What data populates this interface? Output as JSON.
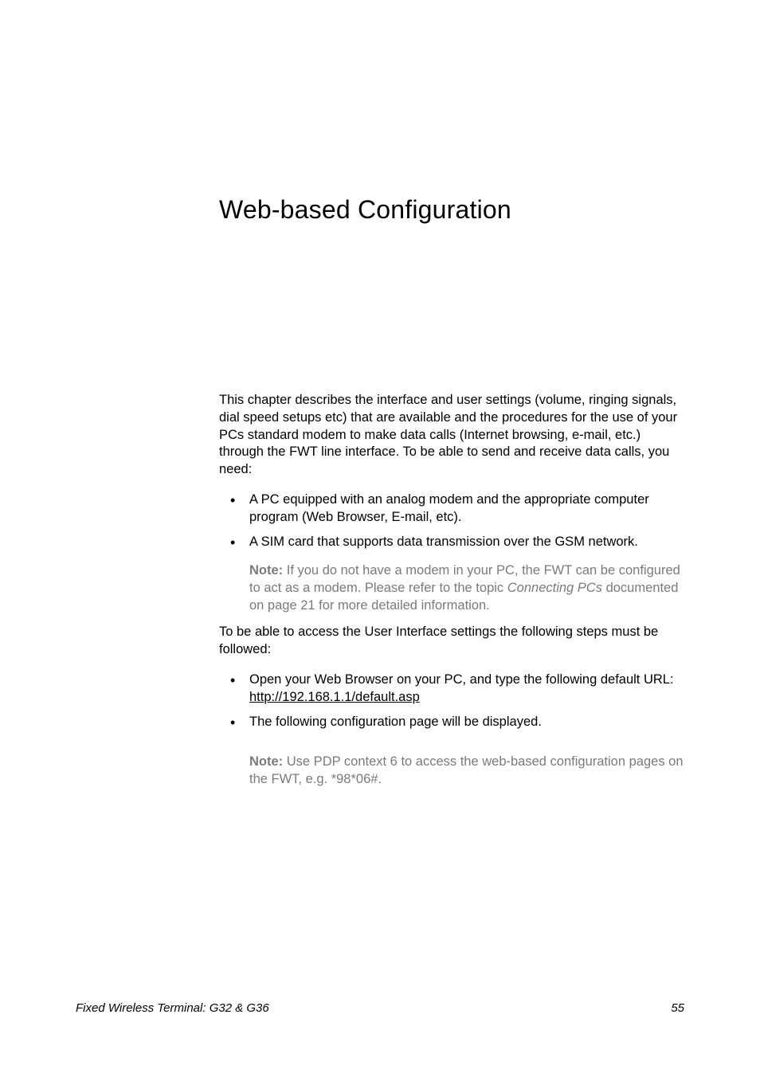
{
  "page": {
    "chapterTitle": "Web-based Configuration",
    "introParagraph": "This chapter describes the interface and user settings (volume, ringing signals, dial speed setups etc) that are available and the procedures for the use of your PCs standard modem to make data calls (Internet browsing, e-mail, etc.) through the FWT line interface. To be able to send and receive data calls, you need:",
    "requirements": [
      "A PC equipped with an analog modem and the appropriate computer program (Web Browser, E-mail, etc).",
      "A SIM card that supports data transmission over the GSM network."
    ],
    "note1": {
      "label": "Note:",
      "text_before": " If you do not have a modem in your PC, the FWT can be configured to act as a modem. Please refer to the topic ",
      "italic": "Connecting PCs",
      "text_after": " documented on page 21 for more detailed information."
    },
    "accessParagraph": "To be able to access the User Interface settings the following steps must be followed:",
    "steps": [
      {
        "text_before": "Open your Web Browser on your PC, and type the following default URL: ",
        "url": "http://192.168.1.1/default.asp"
      },
      {
        "text_before": "The following configuration page will be displayed.",
        "url": ""
      }
    ],
    "note2": {
      "label": "Note:",
      "text": " Use PDP context 6 to access the web-based configuration pages on the FWT, e.g. *98*06#."
    },
    "footer": {
      "title": "Fixed Wireless Terminal: G32 & G36",
      "pageNumber": "55"
    }
  }
}
